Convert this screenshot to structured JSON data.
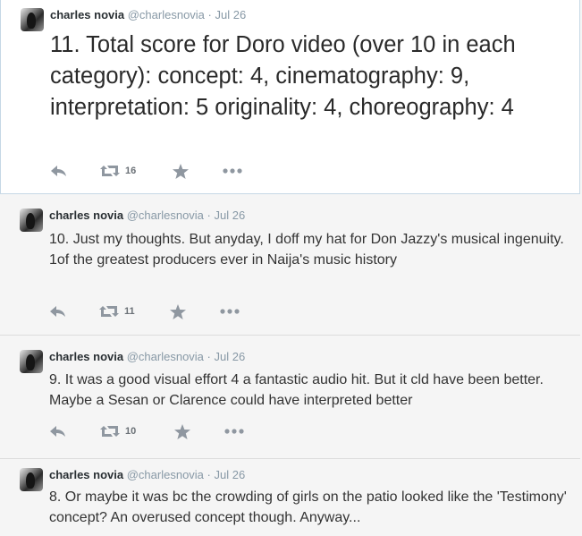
{
  "tweets": [
    {
      "name": "charles novia",
      "handle": "@charlesnovia",
      "separator": "·",
      "time": "Jul 26",
      "text": "11. Total score for Doro video (over 10 in each category): concept: 4, cinematography: 9,  interpretation: 5 originality: 4, choreography: 4",
      "retweets": "16"
    },
    {
      "name": "charles novia",
      "handle": "@charlesnovia",
      "separator": "·",
      "time": "Jul 26",
      "text": "10. Just my thoughts. But anyday, I doff my hat for Don Jazzy's musical ingenuity. 1of the greatest producers ever in Naija's music history",
      "retweets": "11"
    },
    {
      "name": "charles novia",
      "handle": "@charlesnovia",
      "separator": "·",
      "time": "Jul 26",
      "text": "9. It was a good visual effort 4 a fantastic audio hit. But it cld have been better. Maybe a Sesan or Clarence could have interpreted better",
      "retweets": "10"
    },
    {
      "name": "charles novia",
      "handle": "@charlesnovia",
      "separator": "·",
      "time": "Jul 26",
      "text": "8. Or maybe it was bc the crowding of girls on the patio looked like the 'Testimony' concept? An overused concept though. Anyway..."
    }
  ],
  "icons": {
    "reply": "reply-icon",
    "retweet": "retweet-icon",
    "favorite": "star-icon",
    "more": "more-icon"
  },
  "colors": {
    "highlight_border": "#c6d8e6",
    "muted": "#8899a6",
    "action_icon": "#8f97a0"
  }
}
